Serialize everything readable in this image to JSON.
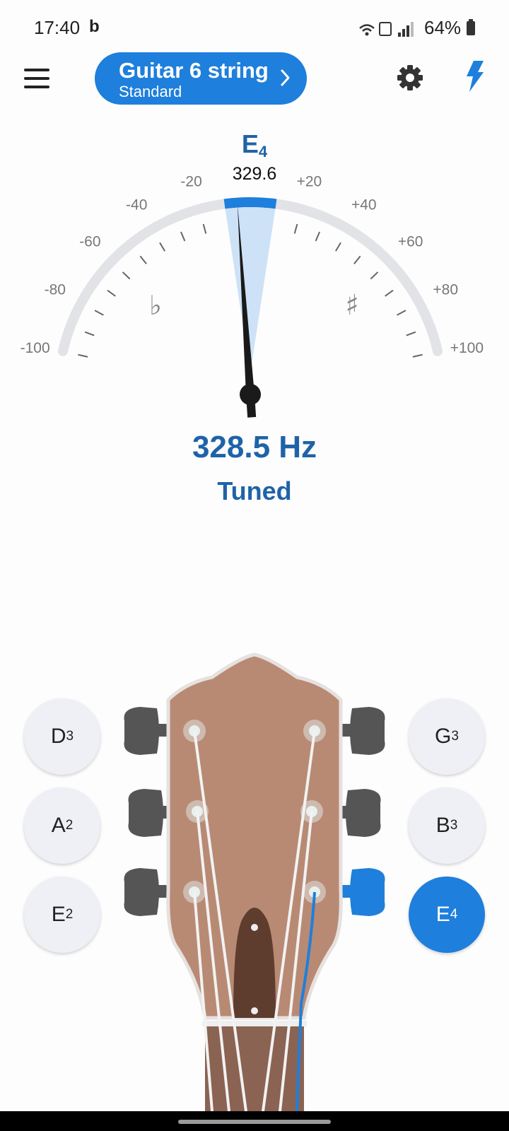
{
  "status_bar": {
    "time": "17:40",
    "app_badge": "b",
    "battery": "64%"
  },
  "top_bar": {
    "instrument_name": "Guitar 6 string",
    "tuning": "Standard",
    "accent": "#1e7fdc"
  },
  "tuner": {
    "target_note": "E",
    "target_octave": "4",
    "reference_frequency": "329.6",
    "scale_labels": [
      "-100",
      "-80",
      "-60",
      "-40",
      "-20",
      "+20",
      "+40",
      "+60",
      "+80",
      "+100"
    ],
    "flat_symbol": "♭",
    "sharp_symbol": "♯",
    "needle_cents": -5,
    "in_tune_range_cents": 5,
    "measured_frequency": "328.5 Hz",
    "status": "Tuned"
  },
  "strings": {
    "left": [
      {
        "note": "D",
        "octave": "3"
      },
      {
        "note": "A",
        "octave": "2"
      },
      {
        "note": "E",
        "octave": "2"
      }
    ],
    "right": [
      {
        "note": "G",
        "octave": "3"
      },
      {
        "note": "B",
        "octave": "3"
      },
      {
        "note": "E",
        "octave": "4"
      }
    ],
    "selected": "E4"
  },
  "colors": {
    "headstock_wood": "#b88a74",
    "headstock_inlay": "#5e3d2e",
    "peg": "#555555",
    "active": "#1e7fdc",
    "fretboard": "#8b6352"
  }
}
